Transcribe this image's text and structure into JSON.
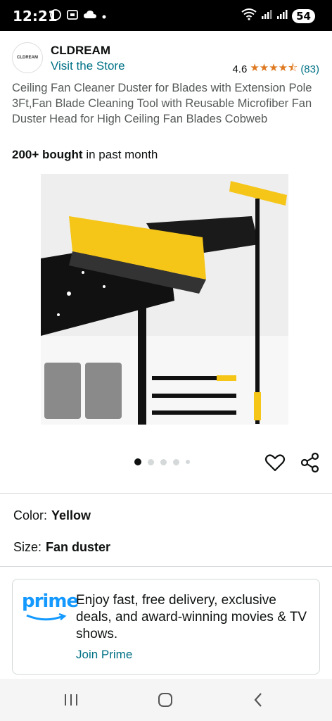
{
  "status_bar": {
    "time": "12:21",
    "battery": "54",
    "left_icons": [
      "whatsapp-icon",
      "screenshot-icon",
      "cloud-icon",
      "dot-icon"
    ],
    "right_icons": [
      "wifi-icon",
      "signal-icon",
      "signal-icon"
    ]
  },
  "store": {
    "logo_text": "CLDREAM",
    "brand": "CLDREAM",
    "visit_link": "Visit the Store",
    "rating": "4.6",
    "rating_count": "(83)",
    "stars": "★★★★⯪"
  },
  "product": {
    "title": "Ceiling Fan Cleaner Duster for Blades with Extension Pole 3Ft,Fan Blade Cleaning Tool with Reusable Microfiber Fan Duster Head for High Ceiling Fan Blades Cobweb",
    "bought_bold": "200+ bought",
    "bought_rest": " in past month",
    "image_count": 5,
    "current_image": 1
  },
  "options": {
    "color_label": "Color:",
    "color_value": "Yellow",
    "size_label": "Size:",
    "size_value": "Fan duster"
  },
  "prime": {
    "logo": "prime",
    "text": "Enjoy fast, free delivery, exclusive deals, and award-winning movies & TV shows.",
    "link": "Join Prime"
  },
  "colors": {
    "link": "#007185",
    "star": "#de7921",
    "prime_blue": "#1399ff",
    "product_yellow": "#f5c518"
  }
}
